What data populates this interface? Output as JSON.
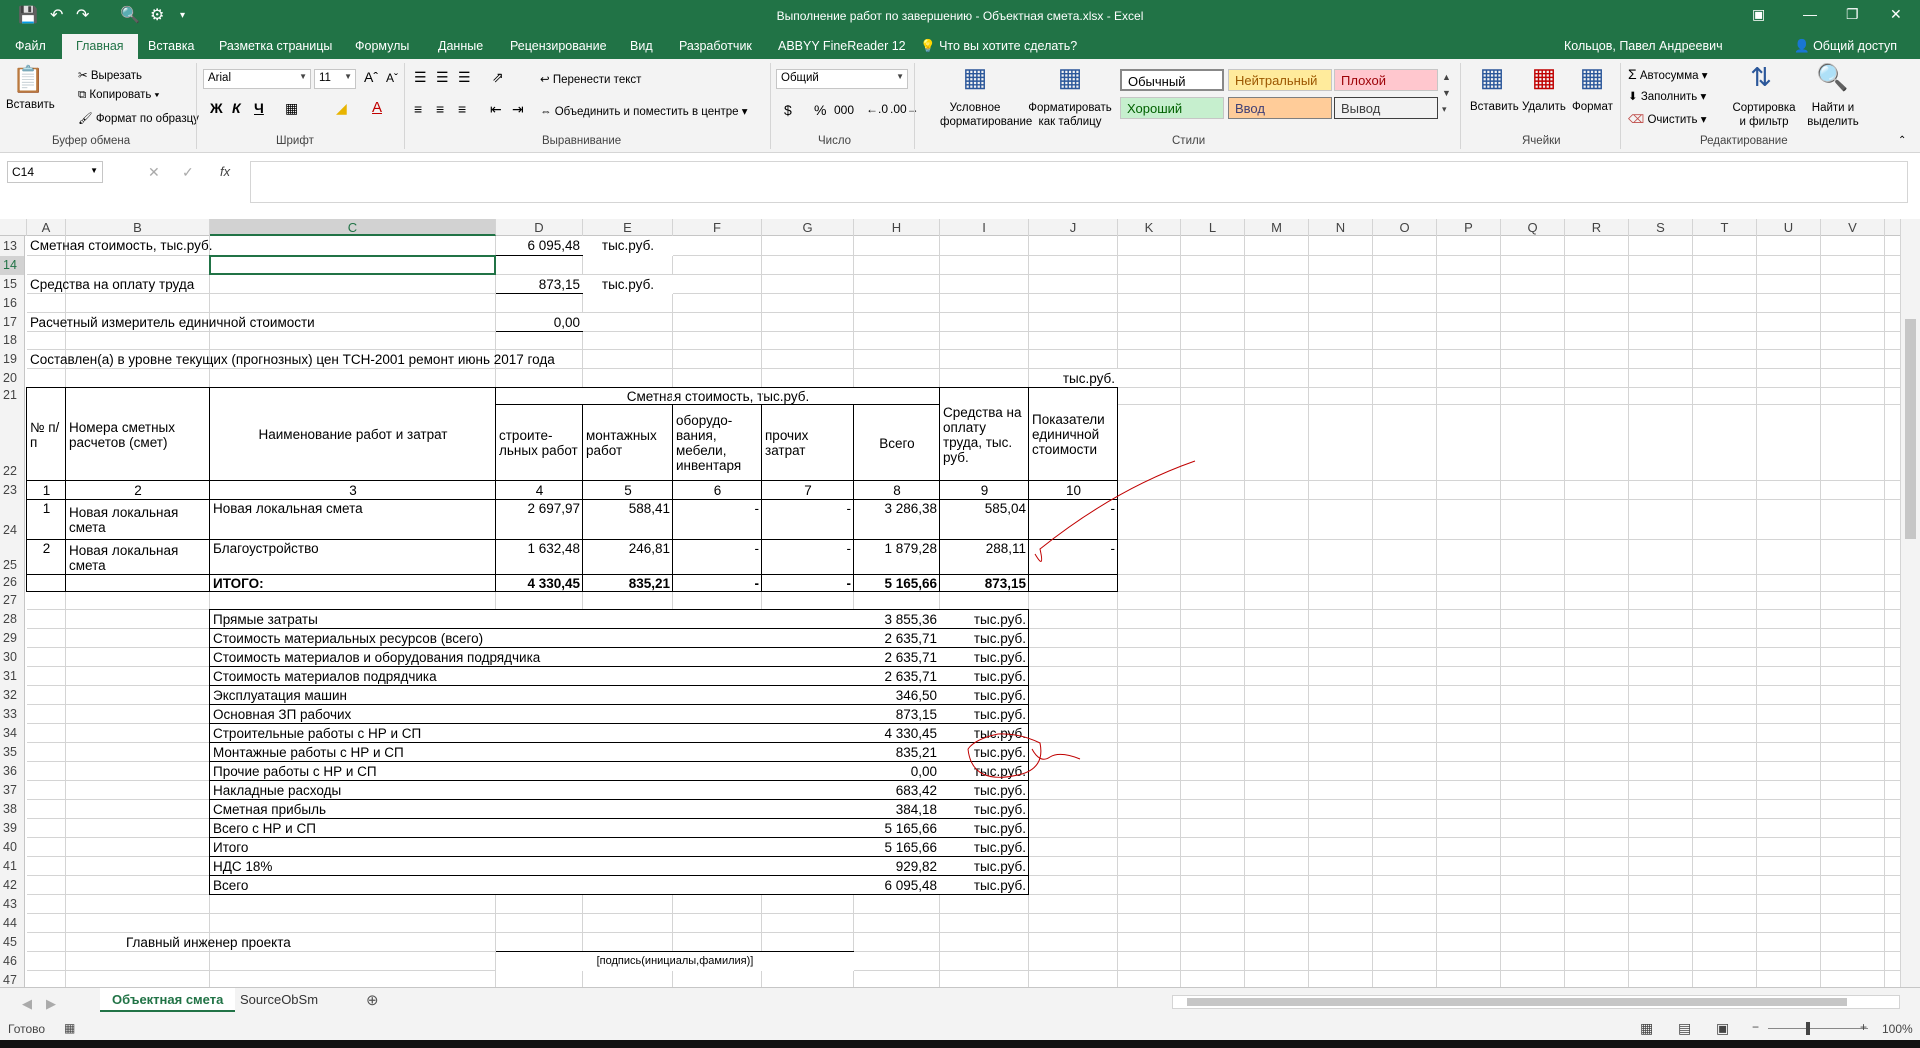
{
  "window": {
    "title": "Выполнение работ по завершению - Объектная смета.xlsx - Excel",
    "user": "Кольцов, Павел Андреевич",
    "share": "Общий доступ"
  },
  "tabs": [
    "Файл",
    "Главная",
    "Вставка",
    "Разметка страницы",
    "Формулы",
    "Данные",
    "Рецензирование",
    "Вид",
    "Разработчик",
    "ABBYY FineReader 12"
  ],
  "tell_me": "Что вы хотите сделать?",
  "ribbon": {
    "paste": "Вставить",
    "cut": "Вырезать",
    "copy": "Копировать",
    "format_painter": "Формат по образцу",
    "clipboard_group": "Буфер обмена",
    "font_name": "Arial",
    "font_size": "11",
    "bold": "Ж",
    "italic": "К",
    "underline": "Ч",
    "font_group": "Шрифт",
    "wrap_text": "Перенести текст",
    "merge_center": "Объединить и поместить в центре",
    "align_group": "Выравнивание",
    "number_format": "Общий",
    "currency": "$",
    "percent": "%",
    "thousands": "000",
    "number_group": "Число",
    "cond_format": "Условное форматирование",
    "format_table": "Форматировать как таблицу",
    "styles": {
      "normal": "Обычный",
      "neutral": "Нейтральный",
      "bad": "Плохой",
      "good": "Хороший",
      "input": "Ввод",
      "output": "Вывод"
    },
    "styles_group": "Стили",
    "insert": "Вставить",
    "delete": "Удалить",
    "format": "Формат",
    "cells_group": "Ячейки",
    "autosum": "Автосумма",
    "fill": "Заполнить",
    "clear": "Очистить",
    "sort_filter": "Сортировка и фильтр",
    "find_select": "Найти и выделить",
    "edit_group": "Редактирование"
  },
  "formula_bar": {
    "name_box": "C14",
    "fx": "fx",
    "formula": ""
  },
  "columns": [
    "A",
    "B",
    "C",
    "D",
    "E",
    "F",
    "G",
    "H",
    "I",
    "J",
    "K",
    "L",
    "M",
    "N",
    "O",
    "P",
    "Q",
    "R",
    "S",
    "T",
    "U",
    "V"
  ],
  "rows": [
    "13",
    "14",
    "15",
    "16",
    "17",
    "18",
    "19",
    "20",
    "21",
    "22",
    "23",
    "24",
    "25",
    "26",
    "27",
    "28",
    "29",
    "30",
    "31",
    "32",
    "33",
    "34",
    "35",
    "36",
    "37",
    "38",
    "39",
    "40",
    "41",
    "42",
    "43",
    "44",
    "45",
    "46",
    "47"
  ],
  "top": {
    "r13_label": "Сметная стоимость, тыс.руб.",
    "r13_value": "6 095,48",
    "r13_unit": "тыс.руб.",
    "r15_label": "Средства на оплату труда",
    "r15_value": "873,15",
    "r15_unit": "тыс.руб.",
    "r17_label": "Расчетный измеритель единичной стоимости",
    "r17_value": "0,00",
    "r19_text": "Составлен(а) в уровне текущих (прогнозных) цен ТСН-2001 ремонт июнь 2017 года",
    "r20_unit": "тыс.руб."
  },
  "table": {
    "h_no": "№ п/п",
    "h_calc": "Номера сметных расчетов (смет)",
    "h_name": "Наименование работ и затрат",
    "h_cost": "Сметная стоимость, тыс.руб.",
    "h_build": "строите-льных работ",
    "h_mount": "монтажных работ",
    "h_equip": "оборудо-вания, мебели, инвентаря",
    "h_other": "прочих затрат",
    "h_total": "Всего",
    "h_wages": "Средства на оплату труда, тыс. руб.",
    "h_unit": "Показатели единичной стоимости",
    "nums": [
      "1",
      "2",
      "3",
      "4",
      "5",
      "6",
      "7",
      "8",
      "9",
      "10"
    ],
    "rows": [
      {
        "no": "1",
        "calc": "Новая локальная смета",
        "name": "Новая локальная смета",
        "build": "2 697,97",
        "mount": "588,41",
        "equip": "-",
        "other": "-",
        "total": "3 286,38",
        "wages": "585,04",
        "unit": "-"
      },
      {
        "no": "2",
        "calc": "Новая локальная смета",
        "name": "Благоустройство",
        "build": "1 632,48",
        "mount": "246,81",
        "equip": "-",
        "other": "-",
        "total": "1 879,28",
        "wages": "288,11",
        "unit": "-"
      }
    ],
    "total": {
      "name": "ИТОГО:",
      "build": "4 330,45",
      "mount": "835,21",
      "equip": "-",
      "other": "-",
      "total": "5 165,66",
      "wages": "873,15"
    }
  },
  "summary": [
    {
      "label": "Прямые затраты",
      "value": "3 855,36",
      "unit": "тыс.руб."
    },
    {
      "label": "Стоимость материальных ресурсов (всего)",
      "value": "2 635,71",
      "unit": "тыс.руб."
    },
    {
      "label": "Стоимость материалов и оборудования подрядчика",
      "value": "2 635,71",
      "unit": "тыс.руб."
    },
    {
      "label": "Стоимость материалов подрядчика",
      "value": "2 635,71",
      "unit": "тыс.руб."
    },
    {
      "label": "Эксплуатация машин",
      "value": "346,50",
      "unit": "тыс.руб."
    },
    {
      "label": "Основная ЗП рабочих",
      "value": "873,15",
      "unit": "тыс.руб."
    },
    {
      "label": "Строительные работы с НР и СП",
      "value": "4 330,45",
      "unit": "тыс.руб."
    },
    {
      "label": "Монтажные работы с НР и СП",
      "value": "835,21",
      "unit": "тыс.руб."
    },
    {
      "label": "Прочие работы с НР и СП",
      "value": "0,00",
      "unit": "тыс.руб."
    },
    {
      "label": "Накладные расходы",
      "value": "683,42",
      "unit": "тыс.руб."
    },
    {
      "label": "Сметная прибыль",
      "value": "384,18",
      "unit": "тыс.руб."
    },
    {
      "label": "Всего с НР и СП",
      "value": "5 165,66",
      "unit": "тыс.руб."
    },
    {
      "label": "Итого",
      "value": "5 165,66",
      "unit": "тыс.руб."
    },
    {
      "label": "НДС 18%",
      "value": "929,82",
      "unit": "тыс.руб."
    },
    {
      "label": "Всего",
      "value": "6 095,48",
      "unit": "тыс.руб."
    }
  ],
  "signature": {
    "role": "Главный инженер проекта",
    "hint": "[подпись(инициалы,фамилия)]"
  },
  "sheet_tabs": [
    "Объектная смета",
    "SourceObSm"
  ],
  "status": {
    "ready": "Готово",
    "zoom": "100%"
  }
}
